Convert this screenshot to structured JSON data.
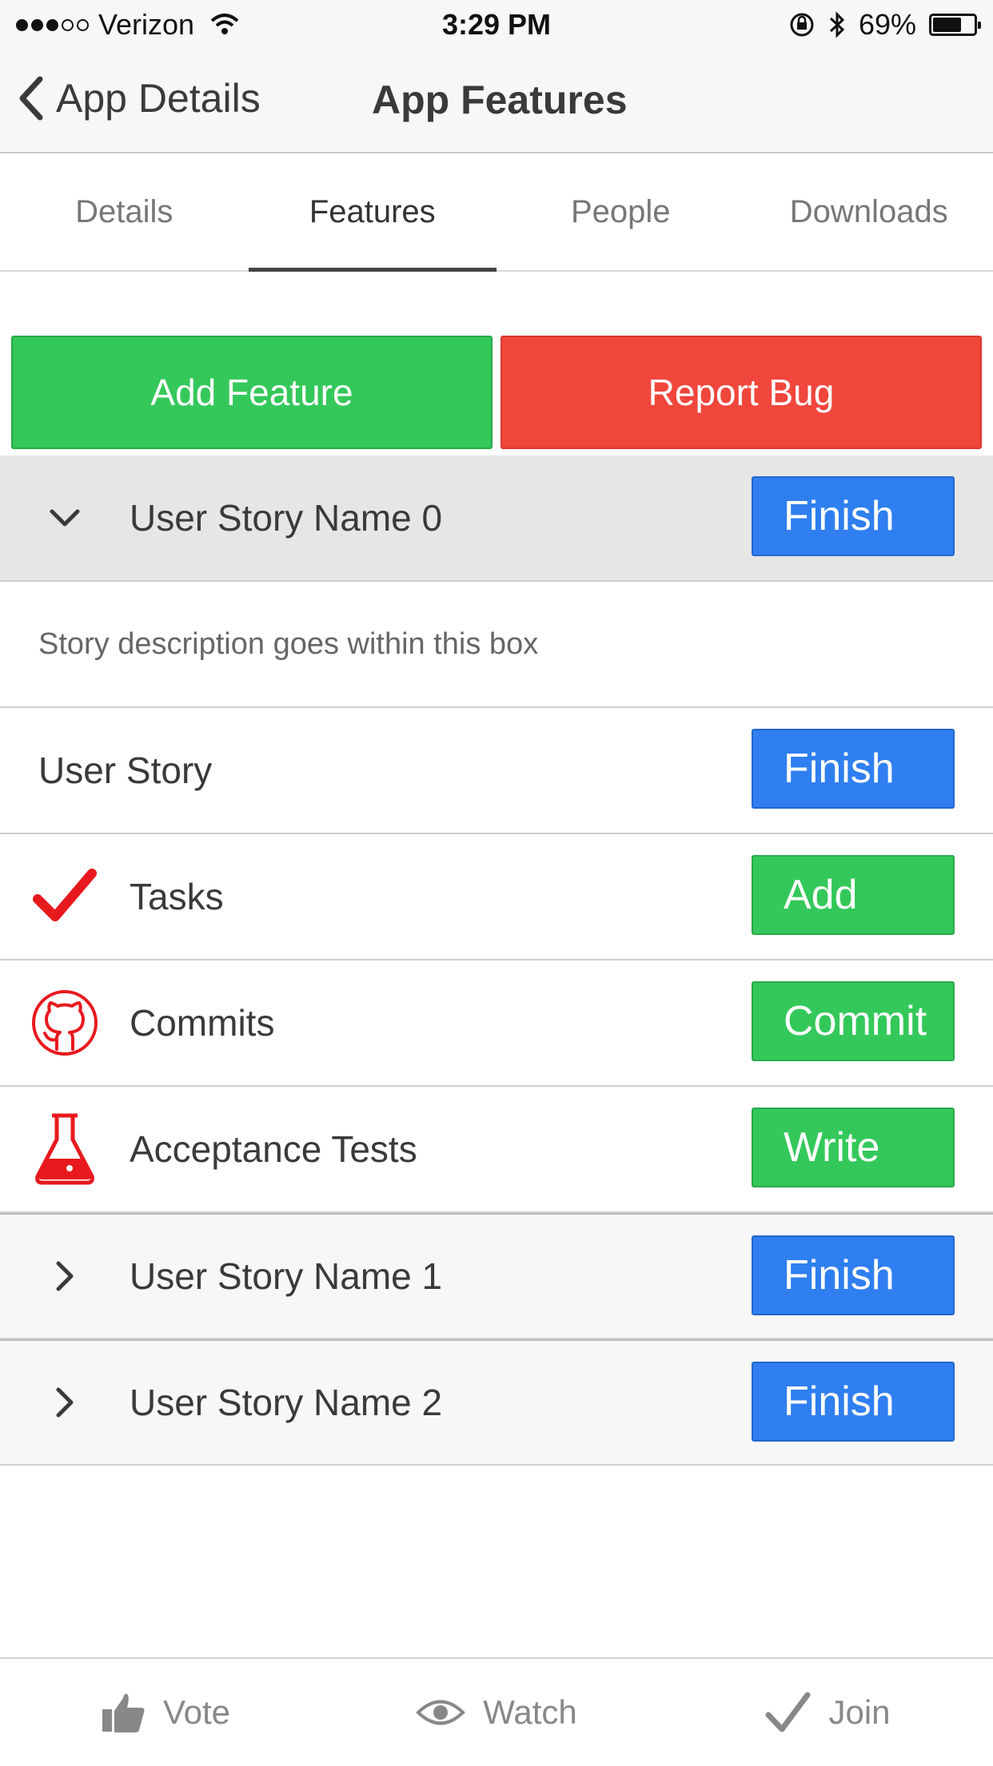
{
  "status_bar": {
    "carrier": "Verizon",
    "time": "3:29 PM",
    "battery": "69%",
    "battery_level": 0.69
  },
  "nav": {
    "back_label": "App Details",
    "title": "App Features"
  },
  "tabs": [
    {
      "label": "Details",
      "active": false
    },
    {
      "label": "Features",
      "active": true
    },
    {
      "label": "People",
      "active": false
    },
    {
      "label": "Downloads",
      "active": false
    }
  ],
  "actions": {
    "add_feature": "Add Feature",
    "report_bug": "Report Bug"
  },
  "stories": [
    {
      "name": "User Story Name 0",
      "button": "Finish",
      "expanded": true
    },
    {
      "name": "User Story Name 1",
      "button": "Finish",
      "expanded": false
    },
    {
      "name": "User Story Name 2",
      "button": "Finish",
      "expanded": false
    }
  ],
  "expanded": {
    "description": "Story description goes within this box",
    "rows": [
      {
        "label": "User Story",
        "button": "Finish",
        "icon": "none"
      },
      {
        "label": "Tasks",
        "button": "Add",
        "icon": "checkmark-icon"
      },
      {
        "label": "Commits",
        "button": "Commit",
        "icon": "github-icon"
      },
      {
        "label": "Acceptance Tests",
        "button": "Write",
        "icon": "flask-icon"
      }
    ]
  },
  "toolbar": {
    "vote": "Vote",
    "watch": "Watch",
    "join": "Join"
  },
  "colors": {
    "green": "#34c85a",
    "red": "#f0463c",
    "blue": "#2f7ff0",
    "icon_red": "#e8191e"
  }
}
